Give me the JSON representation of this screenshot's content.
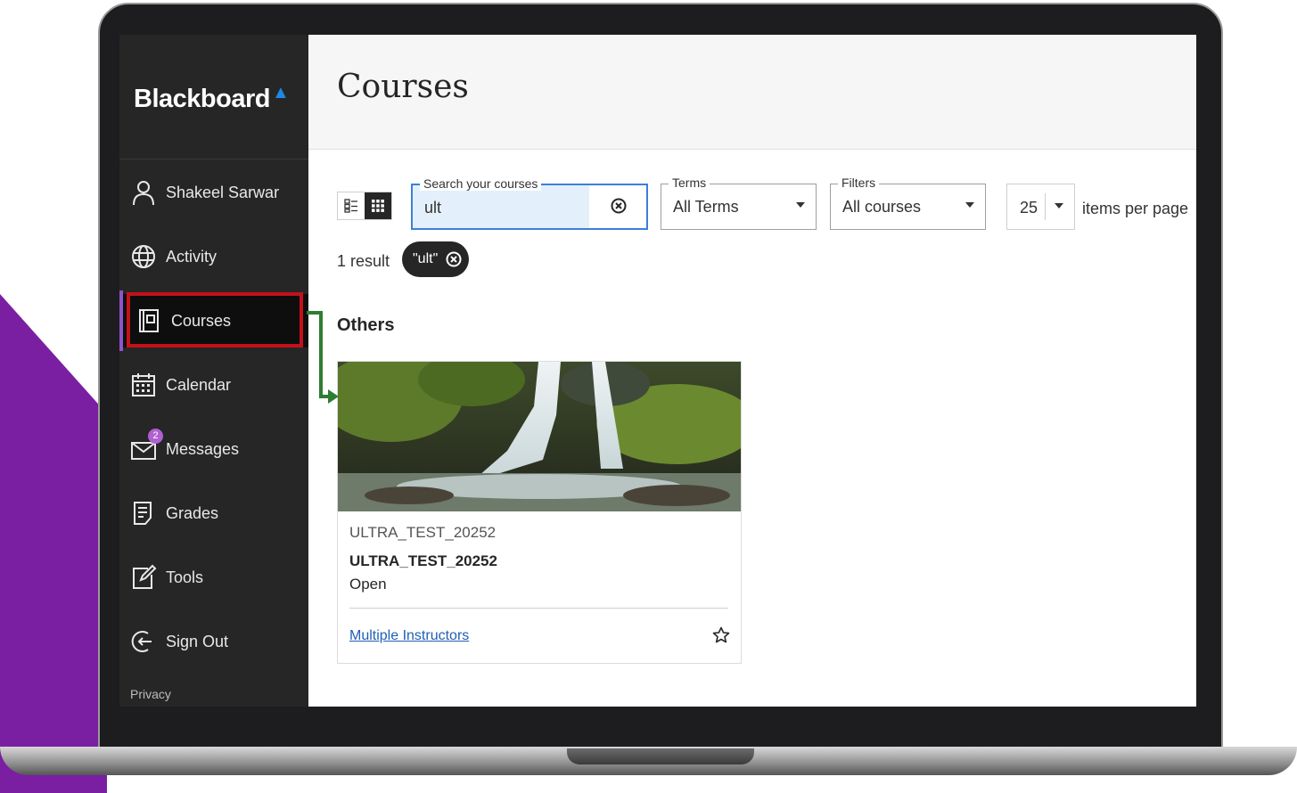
{
  "brand": {
    "name": "Blackboard",
    "accent": "#1e88e5"
  },
  "sidebar": {
    "items": [
      {
        "label": "Shakeel Sarwar",
        "icon": "user-icon"
      },
      {
        "label": "Activity",
        "icon": "globe-icon"
      },
      {
        "label": "Courses",
        "icon": "courses-icon",
        "active": true
      },
      {
        "label": "Calendar",
        "icon": "calendar-icon"
      },
      {
        "label": "Messages",
        "icon": "envelope-icon",
        "badge": "2"
      },
      {
        "label": "Grades",
        "icon": "grades-icon"
      },
      {
        "label": "Tools",
        "icon": "tools-icon"
      },
      {
        "label": "Sign Out",
        "icon": "sign-out-icon"
      }
    ],
    "privacy": "Privacy"
  },
  "header": {
    "title": "Courses"
  },
  "search": {
    "label": "Search your courses",
    "value": "ult"
  },
  "terms": {
    "label": "Terms",
    "value": "All Terms"
  },
  "filters": {
    "label": "Filters",
    "value": "All courses"
  },
  "paging": {
    "per_page": "25",
    "label": "items per page"
  },
  "results": {
    "count": "1 result",
    "chip": "\"ult\""
  },
  "section": {
    "title": "Others"
  },
  "course": {
    "id": "ULTRA_TEST_20252",
    "name": "ULTRA_TEST_20252",
    "status": "Open",
    "instructors": "Multiple Instructors"
  },
  "colors": {
    "highlight_box": "#c3111a",
    "arrow": "#2e7d32",
    "background_shape": "#7b1fa2"
  }
}
